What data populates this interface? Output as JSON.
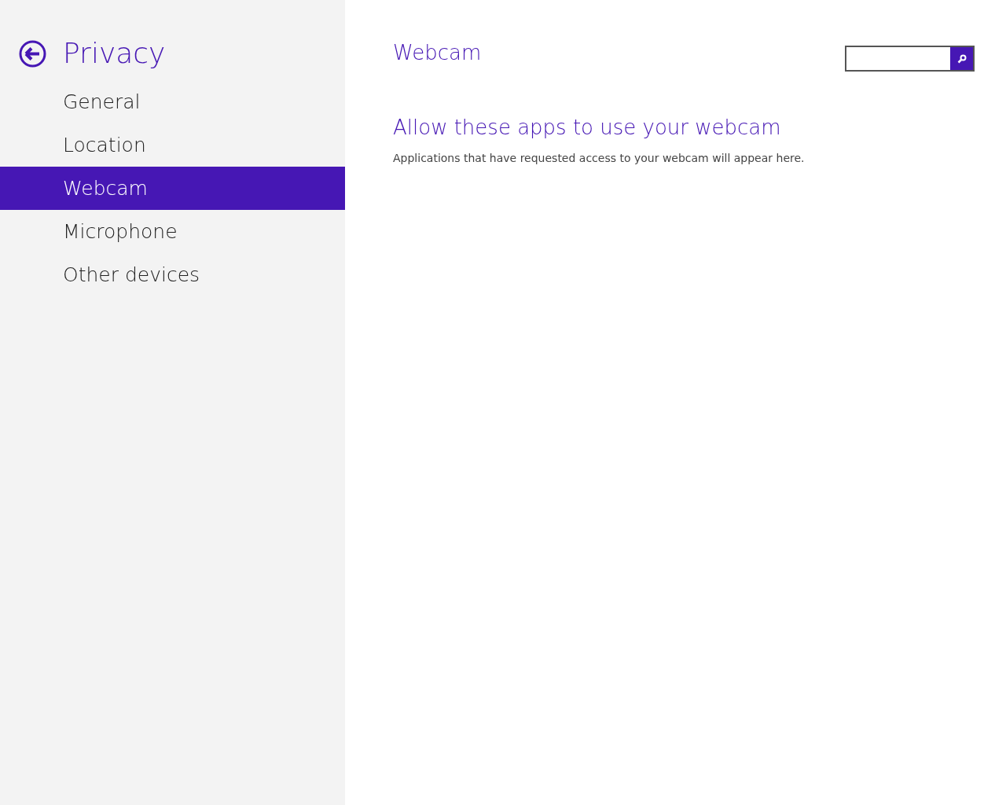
{
  "sidebar": {
    "title": "Privacy",
    "items": [
      {
        "label": "General",
        "selected": false
      },
      {
        "label": "Location",
        "selected": false
      },
      {
        "label": "Webcam",
        "selected": true
      },
      {
        "label": "Microphone",
        "selected": false
      },
      {
        "label": "Other devices",
        "selected": false
      }
    ]
  },
  "content": {
    "title": "Webcam",
    "heading": "Allow these apps to use your webcam",
    "description": "Applications that have requested access to your webcam will appear here."
  }
}
